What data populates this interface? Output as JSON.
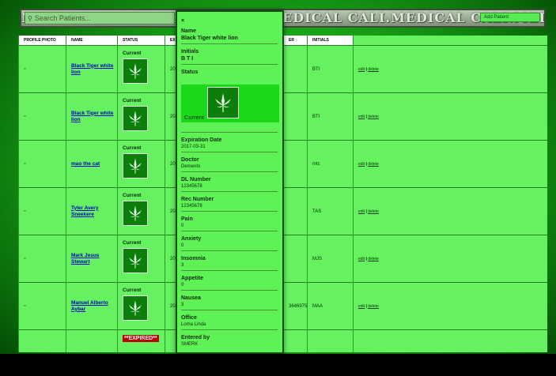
{
  "header": {
    "wordmark": "MEDICAL CALI.MEDICAL CALI.MEDICAL CALI.MEDICAL CALI.MEDICAL CALI.MEDICAL",
    "search_placeholder": "Search Patients...",
    "add_patient_label": "Add Patient"
  },
  "table": {
    "columns": {
      "photo": "PROFILE PHOTO",
      "name": "NAME",
      "status": "STATUS",
      "exp": "EX",
      "rec": "ER",
      "initials": "INITIALS"
    },
    "rows": [
      {
        "name": "Black Tiger white lion",
        "status": "Current",
        "exp_partial": "20",
        "rec_partial": "",
        "initials": "BTI"
      },
      {
        "name": "Black Tiger white lion",
        "status": "Current",
        "exp_partial": "20",
        "rec_partial": "",
        "initials": "BTI"
      },
      {
        "name": "mao the cat",
        "status": "Current",
        "exp_partial": "20",
        "rec_partial": "",
        "initials": "mtc"
      },
      {
        "name": "Tyler Avery Sneekere",
        "status": "Current",
        "exp_partial": "20",
        "rec_partial": "",
        "initials": "TAS"
      },
      {
        "name": "Mark Jesus Stewart",
        "status": "Current",
        "exp_partial": "20",
        "rec_partial": "",
        "initials": "MJS"
      },
      {
        "name": "Manuel Alberto Aybar",
        "status": "Current",
        "exp_partial": "20",
        "rec_partial": "3646975",
        "initials": "MAA"
      }
    ],
    "last_row_status": "**EXPIRED**",
    "edit_label": "edit",
    "delete_label": "delete",
    "separator": "|"
  },
  "modal": {
    "close": "×",
    "name_label": "Name",
    "name_value": "Black Tiger white lion",
    "initials_label": "Initials",
    "initials_value": "B T I",
    "status_label": "Status",
    "status_value": "Current",
    "expiration_label": "Expiration Date",
    "expiration_value": "2017-03-31",
    "doctor_label": "Doctor",
    "doctor_value": "Demento",
    "dl_label": "DL Number",
    "dl_value": "12345678",
    "rec_label": "Rec Number",
    "rec_value": "12345678",
    "pain_label": "Pain",
    "pain_value": "0",
    "anxiety_label": "Anxiety",
    "anxiety_value": "0",
    "insomnia_label": "Insomnia",
    "insomnia_value": "3",
    "appetite_label": "Appetite",
    "appetite_value": "0",
    "nausea_label": "Nausea",
    "nausea_value": "3",
    "office_label": "Office",
    "office_value": "Loma Linda",
    "entered_label": "Entered by",
    "entered_value": "SMERK"
  },
  "colors": {
    "accent": "#66f160",
    "link": "#0000cc",
    "expired": "#bb0000"
  },
  "icons": [
    "search-icon",
    "cannabis-leaf-icon",
    "photo-placeholder-icon",
    "close-icon"
  ]
}
